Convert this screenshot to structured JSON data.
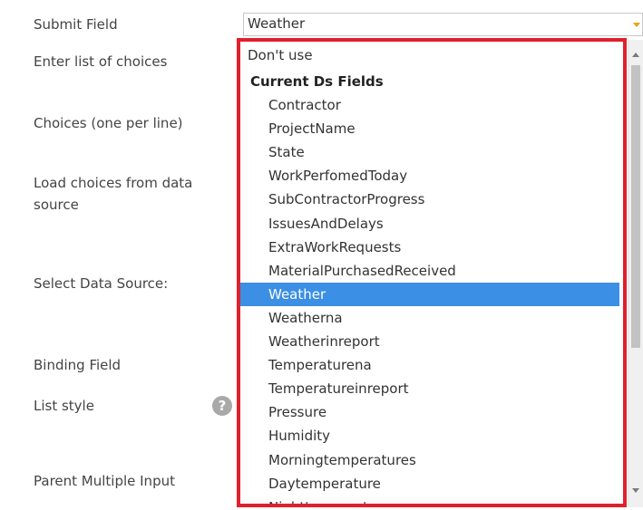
{
  "form": {
    "labels": {
      "submit_field": "Submit Field",
      "enter_list": "Enter list of choices",
      "choices": "Choices (one per line)",
      "load_choices_1": "Load choices from data",
      "load_choices_2": "source",
      "select_data_source": "Select Data Source:",
      "binding_field": "Binding Field",
      "list_style": "List style",
      "parent_multiple_input": "Parent Multiple Input"
    },
    "help_icon_glyph": "?"
  },
  "select": {
    "value": "Weather"
  },
  "dropdown": {
    "dont_use": "Don't use",
    "group_label": "Current Ds Fields",
    "fields": [
      "Contractor",
      "ProjectName",
      "State",
      "WorkPerfomedToday",
      "SubContractorProgress",
      "IssuesAndDelays",
      "ExtraWorkRequests",
      "MaterialPurchasedReceived",
      "Weather",
      "Weatherna",
      "Weatherinreport",
      "Temperaturena",
      "Temperatureinreport",
      "Pressure",
      "Humidity",
      "Morningtemperatures",
      "Daytemperature",
      "Nighttemperature"
    ],
    "selected": "Weather"
  },
  "colors": {
    "highlight_border": "#e0202c",
    "selected_bg": "#3b8fe4",
    "caret": "#e6a41a"
  }
}
